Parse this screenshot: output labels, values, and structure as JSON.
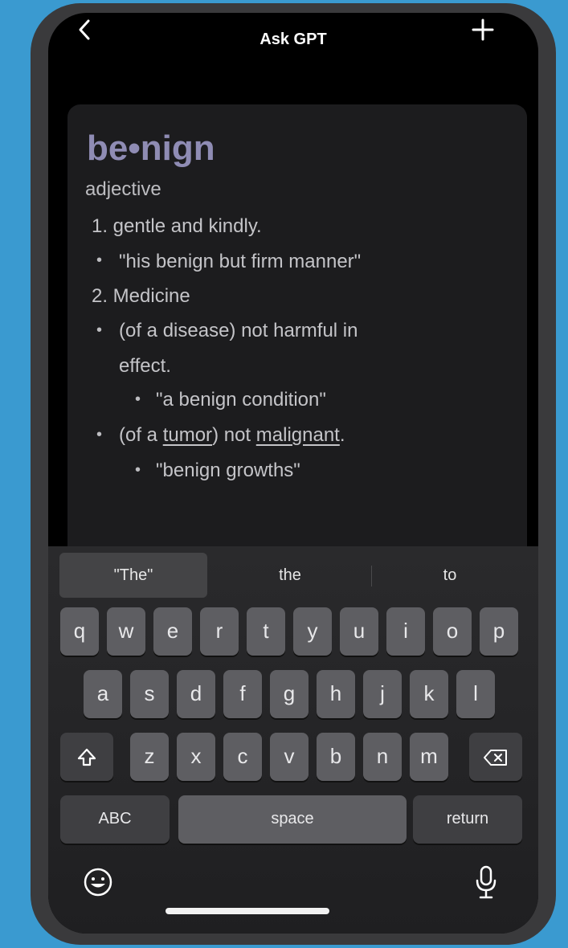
{
  "header": {
    "title": "Ask GPT",
    "back_icon": "chevron-left-icon",
    "add_icon": "plus-icon"
  },
  "definition": {
    "word": "be•nign",
    "part_of_speech": "adjective",
    "sense1": "1. gentle and kindly.",
    "sense1_example": "\"his benign but firm manner\"",
    "sense2": "2. Medicine",
    "sense2a_line1": "(of a disease) not harmful in",
    "sense2a_line2": "effect.",
    "sense2a_example": "\"a benign condition\"",
    "sense2b_prefix": "(of a ",
    "sense2b_link1": "tumor",
    "sense2b_middle": ") not ",
    "sense2b_link2": "malignant",
    "sense2b_suffix": ".",
    "sense2b_example": "\"benign growths\""
  },
  "keyboard": {
    "suggestions": [
      "\"The\"",
      "the",
      "to"
    ],
    "row1": [
      "q",
      "w",
      "e",
      "r",
      "t",
      "y",
      "u",
      "i",
      "o",
      "p"
    ],
    "row2": [
      "a",
      "s",
      "d",
      "f",
      "g",
      "h",
      "j",
      "k",
      "l"
    ],
    "row3": [
      "z",
      "x",
      "c",
      "v",
      "b",
      "n",
      "m"
    ],
    "abc_label": "ABC",
    "space_label": "space",
    "return_label": "return",
    "shift_icon": "shift-icon",
    "delete_icon": "backspace-icon",
    "emoji_icon": "emoji-icon",
    "mic_icon": "microphone-icon"
  },
  "colors": {
    "background": "#3a9ad0",
    "word_accent": "#8f8cb4",
    "card": "#1c1c1e",
    "key": "#5e5e62"
  }
}
